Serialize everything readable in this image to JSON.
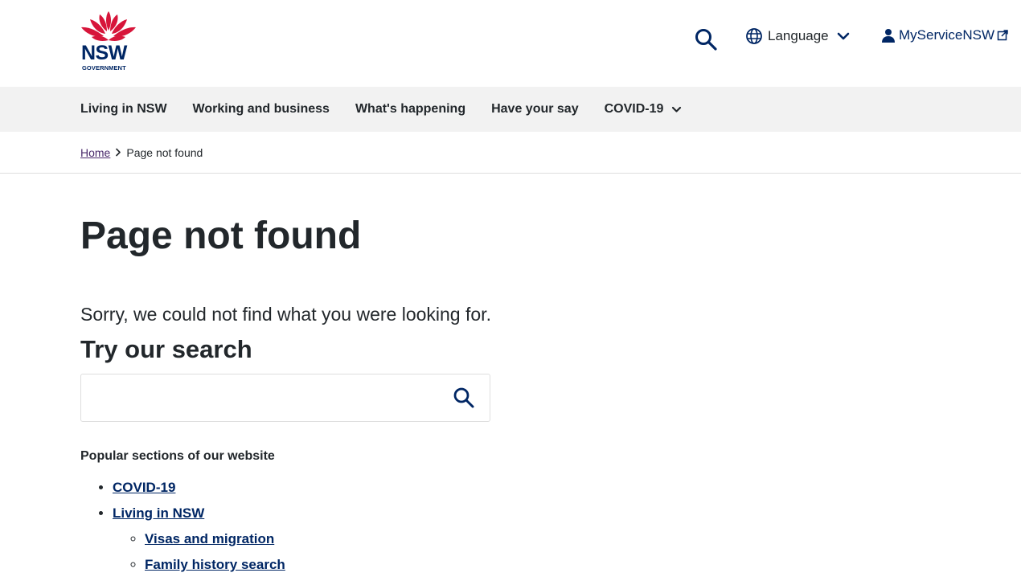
{
  "brand": {
    "name": "NSW",
    "sub": "GOVERNMENT",
    "color": "#002664",
    "accent": "#d7153a"
  },
  "utility": {
    "search_icon": "search-icon",
    "language_label": "Language",
    "myservice_label": "MyServiceNSW"
  },
  "nav": {
    "items": [
      {
        "label": "Living in NSW"
      },
      {
        "label": "Working and business"
      },
      {
        "label": "What's happening"
      },
      {
        "label": "Have your say"
      },
      {
        "label": "COVID-19"
      }
    ]
  },
  "breadcrumb": {
    "home": "Home",
    "current": "Page not found"
  },
  "main": {
    "title": "Page not found",
    "intro": "Sorry, we could not find what you were looking for.",
    "search_heading": "Try our search",
    "search_value": "",
    "popular_heading": "Popular sections of our website",
    "links": [
      {
        "label": "COVID-19"
      },
      {
        "label": "Living in NSW"
      }
    ],
    "sublinks": [
      {
        "label": "Visas and migration"
      },
      {
        "label": "Family history search"
      }
    ]
  }
}
